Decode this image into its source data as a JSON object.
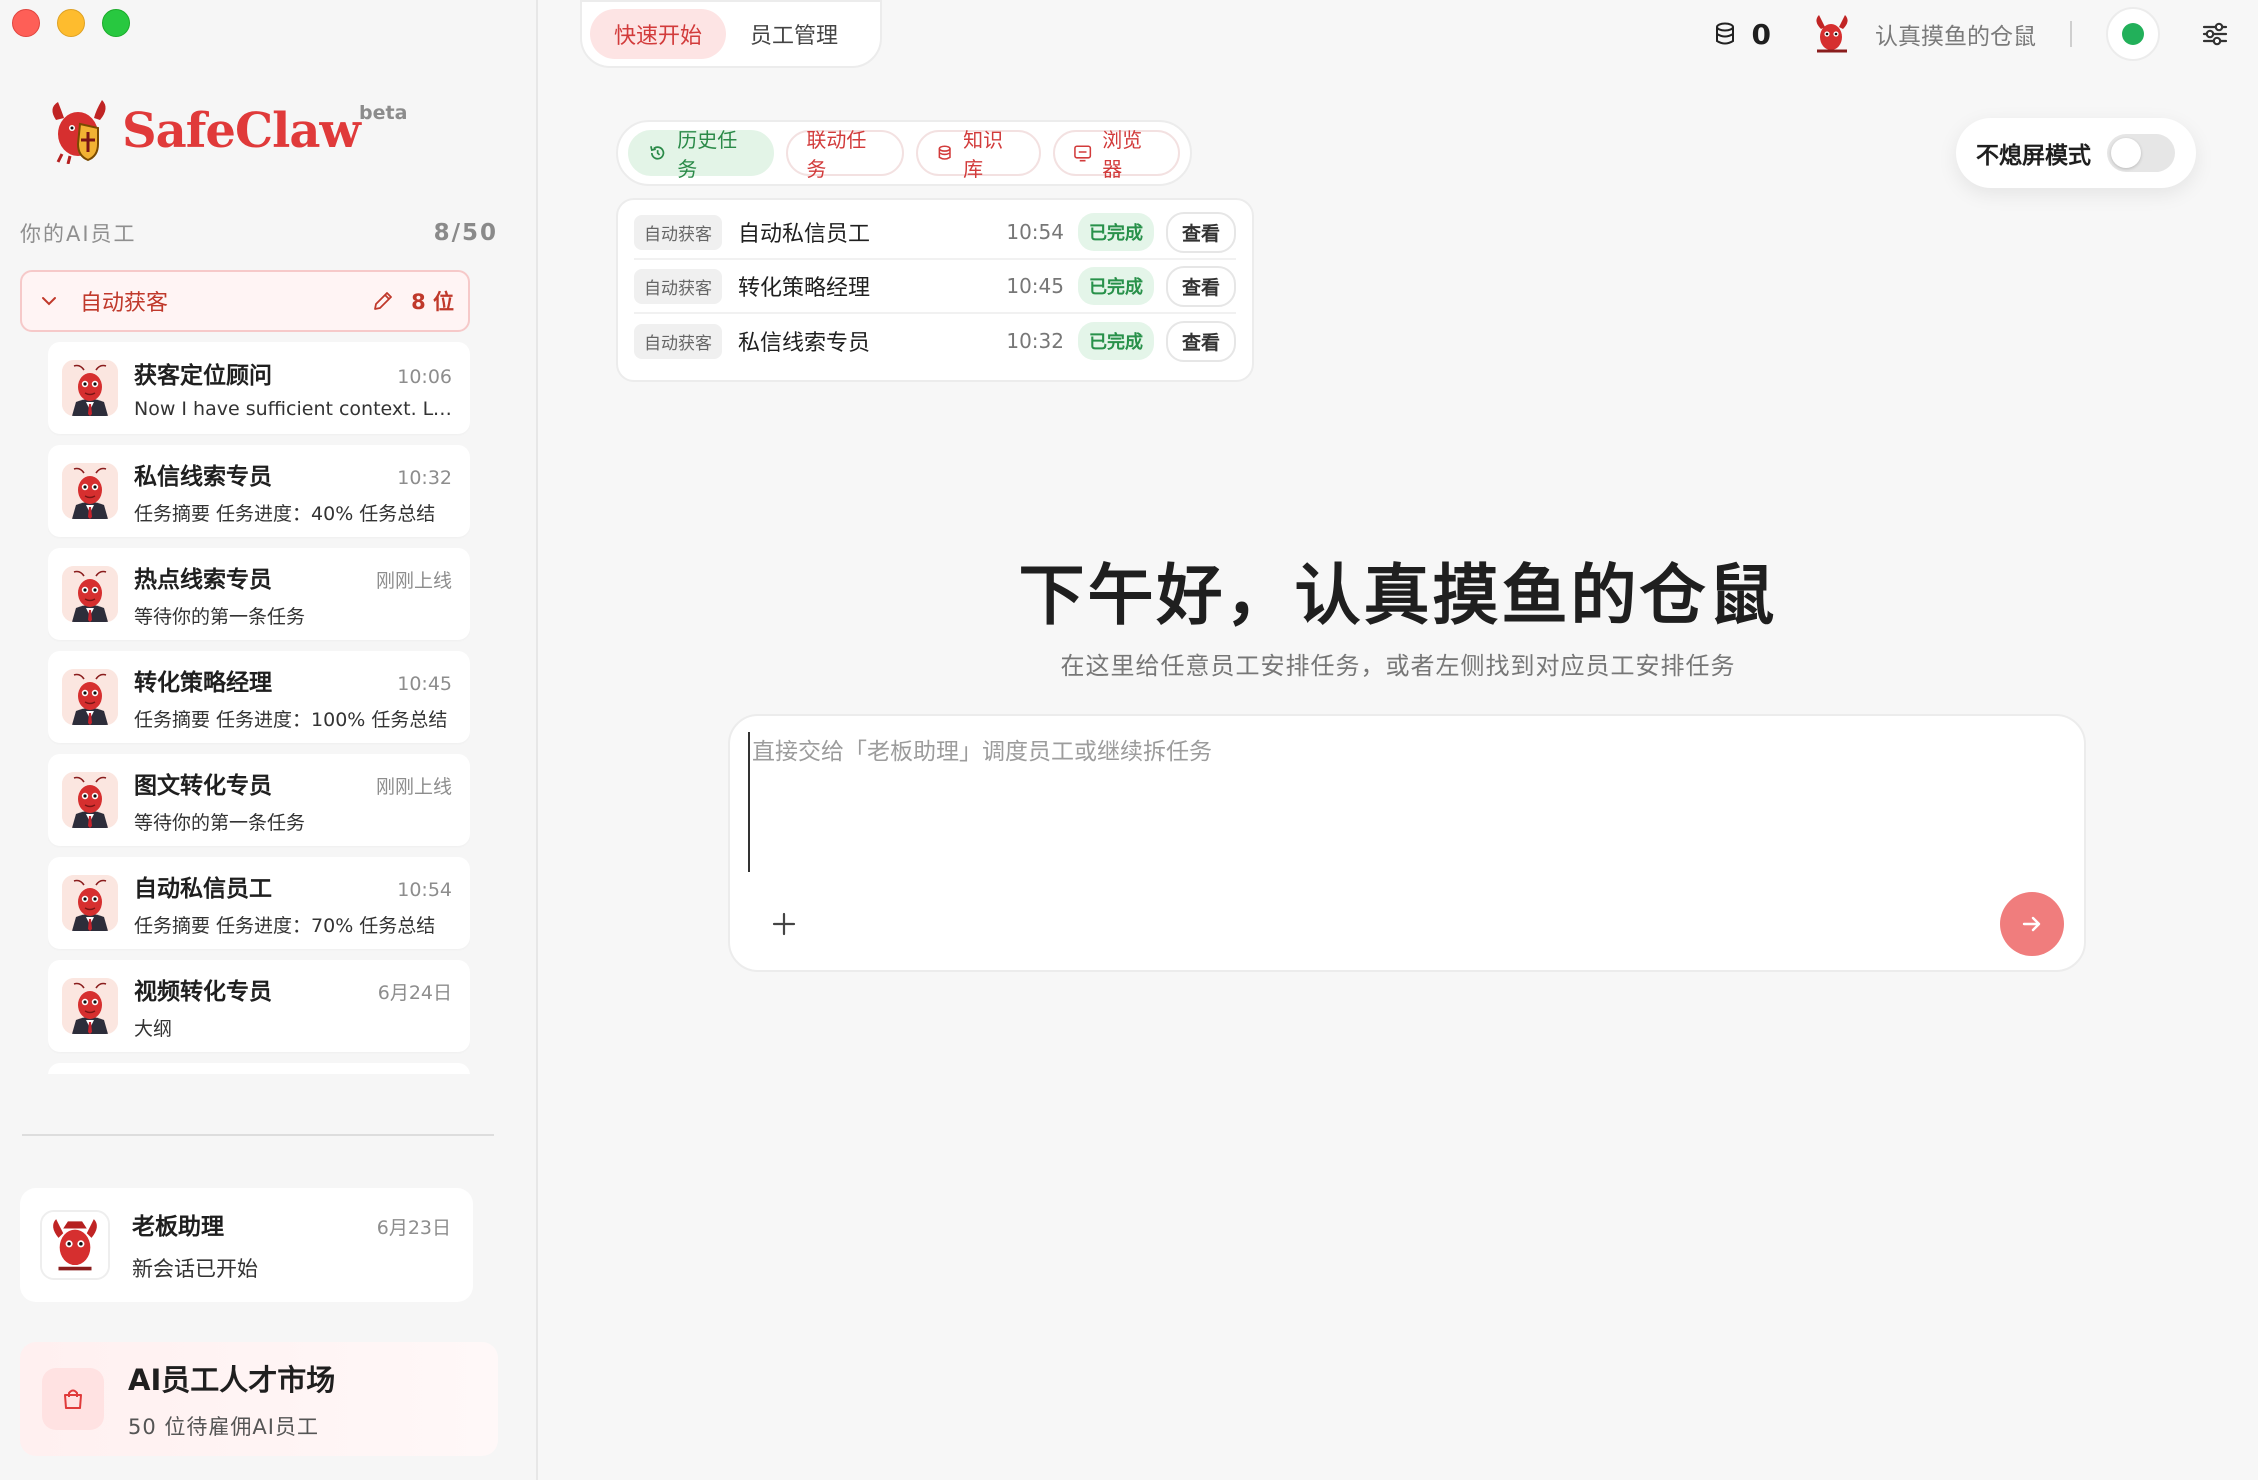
{
  "app": {
    "brand": "SafeClaw",
    "beta": "beta"
  },
  "sidebar": {
    "section_title": "你的AI员工",
    "section_count": "8/50",
    "group": {
      "label": "自动获客",
      "count": "8 位"
    },
    "employees": [
      {
        "name": "获客定位顾问",
        "time": "10:06",
        "preview": "Now I have sufficient context. Let me write the report"
      },
      {
        "name": "私信线索专员",
        "time": "10:32",
        "preview": "任务摘要 任务进度：40% 任务总结"
      },
      {
        "name": "热点线索专员",
        "time": "刚刚上线",
        "preview": "等待你的第一条任务"
      },
      {
        "name": "转化策略经理",
        "time": "10:45",
        "preview": "任务摘要 任务进度：100% 任务总结"
      },
      {
        "name": "图文转化专员",
        "time": "刚刚上线",
        "preview": "等待你的第一条任务"
      },
      {
        "name": "自动私信员工",
        "time": "10:54",
        "preview": "任务摘要 任务进度：70% 任务总结"
      },
      {
        "name": "视频转化专员",
        "time": "6月24日",
        "preview": "大纲"
      }
    ],
    "boss": {
      "name": "老板助理",
      "time": "6月23日",
      "preview": "新会话已开始"
    },
    "market": {
      "title": "AI员工人才市场",
      "subtitle": "50 位待雇佣AI员工"
    }
  },
  "header": {
    "tabs": [
      {
        "label": "快速开始",
        "active": true
      },
      {
        "label": "员工管理",
        "active": false
      }
    ],
    "coins": "0",
    "user_name": "认真摸鱼的仓鼠",
    "status_color": "#22b05a"
  },
  "chips": [
    {
      "label": "历史任务",
      "icon": "history-icon",
      "active": true
    },
    {
      "label": "联动任务",
      "icon": "",
      "active": false
    },
    {
      "label": "知识库",
      "icon": "database-icon",
      "active": false
    },
    {
      "label": "浏览器",
      "icon": "browser-icon",
      "active": false
    }
  ],
  "tasks": [
    {
      "tag": "自动获客",
      "name": "自动私信员工",
      "time": "10:54",
      "status": "已完成",
      "action": "查看"
    },
    {
      "tag": "自动获客",
      "name": "转化策略经理",
      "time": "10:45",
      "status": "已完成",
      "action": "查看"
    },
    {
      "tag": "自动获客",
      "name": "私信线索专员",
      "time": "10:32",
      "status": "已完成",
      "action": "查看"
    }
  ],
  "nosleep": {
    "label": "不熄屏模式",
    "enabled": false
  },
  "main": {
    "greeting": "下午好，认真摸鱼的仓鼠",
    "subtitle": "在这里给任意员工安排任务，或者左侧找到对应员工安排任务",
    "composer_placeholder": "直接交给「老板助理」调度员工或继续拆任务"
  },
  "colors": {
    "accent": "#e03a3a",
    "send": "#f07d7d",
    "success": "#28914a"
  }
}
